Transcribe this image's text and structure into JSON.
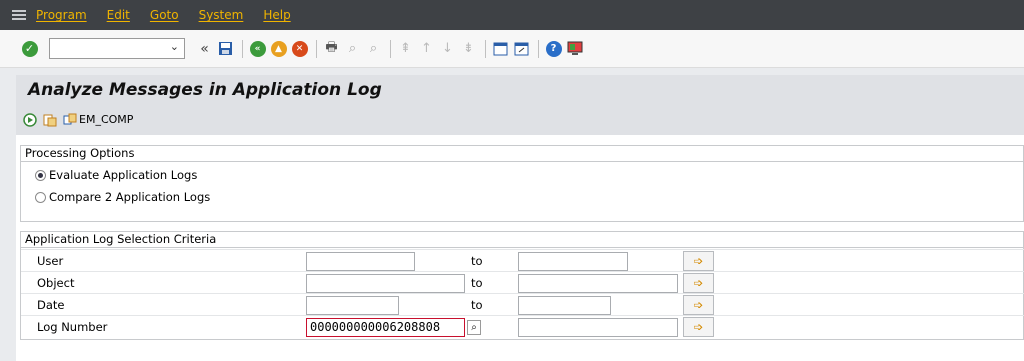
{
  "menu": {
    "items": [
      "Program",
      "Edit",
      "Goto",
      "System",
      "Help"
    ]
  },
  "toolbar": {
    "command_field_value": ""
  },
  "page": {
    "title": "Analyze Messages in Application Log"
  },
  "app_toolbar": {
    "em_comp_label": "EM_COMP"
  },
  "processing_options": {
    "header": "Processing Options",
    "options": [
      {
        "label": "Evaluate Application Logs",
        "selected": true
      },
      {
        "label": "Compare 2 Application Logs",
        "selected": false
      }
    ]
  },
  "selection_criteria": {
    "header": "Application Log Selection Criteria",
    "to_label": "to",
    "rows": [
      {
        "label": "User",
        "from": "",
        "to": ""
      },
      {
        "label": "Object",
        "from": "",
        "to": ""
      },
      {
        "label": "Date",
        "from": "",
        "to": ""
      },
      {
        "label": "Log Number",
        "from": "000000000006208808",
        "to": ""
      }
    ]
  },
  "colors": {
    "menubar_bg": "#3e4145",
    "menu_text": "#f0b400",
    "active_field_border": "#c8102e"
  }
}
